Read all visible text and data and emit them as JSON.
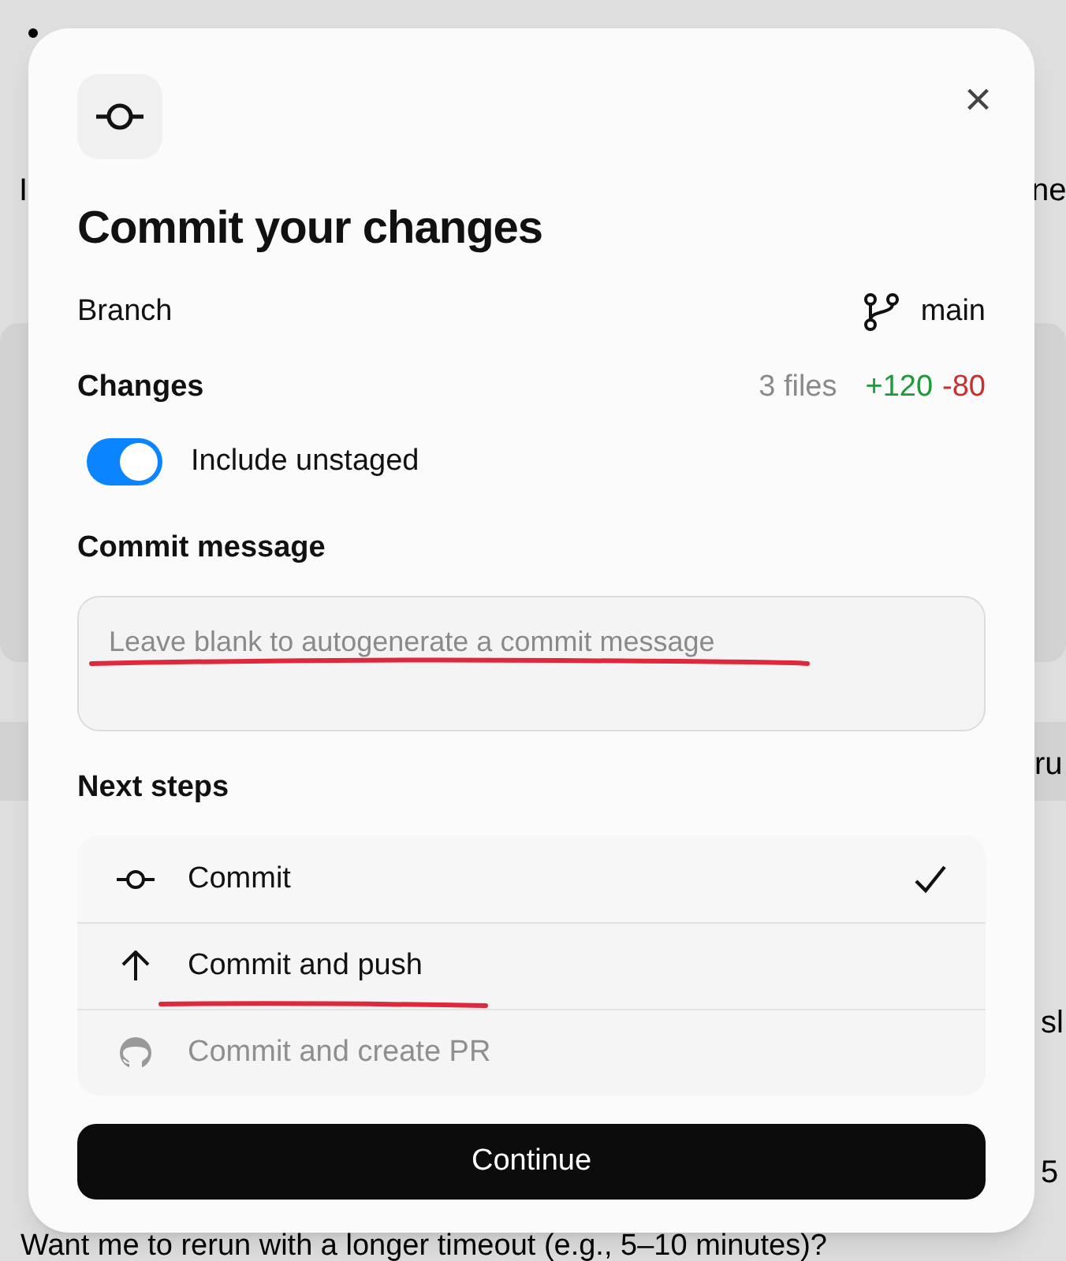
{
  "background": {
    "fragments": [
      "I",
      "ne",
      "ru",
      "sl",
      "5"
    ],
    "footer_text": "Want me to rerun with a longer timeout (e.g., 5–10 minutes)?"
  },
  "dialog": {
    "title": "Commit your changes",
    "close": "×",
    "branch": {
      "label": "Branch",
      "value": "main"
    },
    "changes": {
      "label": "Changes",
      "files": "3 files",
      "added": "+120",
      "removed": "-80"
    },
    "include_unstaged": {
      "label": "Include unstaged",
      "on": true
    },
    "commit_message": {
      "label": "Commit message",
      "placeholder": "Leave blank to autogenerate a commit message",
      "underlined": true
    },
    "next_steps": {
      "label": "Next steps",
      "items": [
        {
          "kind": "commit",
          "label": "Commit",
          "selected": true,
          "disabled": false,
          "underlined": false
        },
        {
          "kind": "push",
          "label": "Commit and push",
          "selected": false,
          "disabled": false,
          "underlined": true
        },
        {
          "kind": "pr",
          "label": "Commit and create PR",
          "selected": false,
          "disabled": true,
          "underlined": false
        }
      ]
    },
    "continue": "Continue"
  }
}
